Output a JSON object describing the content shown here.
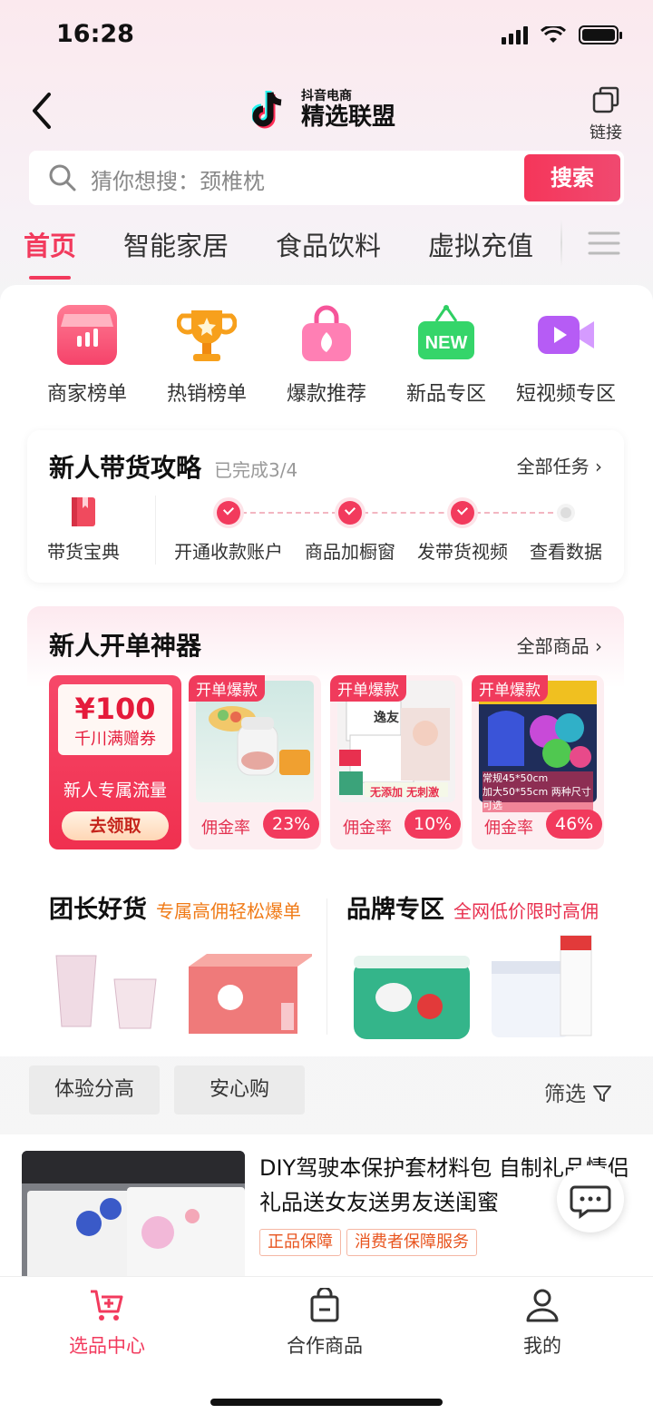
{
  "status": {
    "time": "16:28"
  },
  "header": {
    "logo_small": "抖音电商",
    "logo_big": "精选联盟",
    "link_label": "链接"
  },
  "search": {
    "placeholder": "猜你想搜：颈椎枕",
    "button": "搜索"
  },
  "tabs": [
    {
      "label": "首页"
    },
    {
      "label": "智能家居"
    },
    {
      "label": "食品饮料"
    },
    {
      "label": "虚拟充值"
    }
  ],
  "categories": [
    {
      "label": "商家榜单",
      "icon": "store-chart-icon",
      "color": "#f5436a"
    },
    {
      "label": "热销榜单",
      "icon": "trophy-icon",
      "color": "#f7a01c"
    },
    {
      "label": "爆款推荐",
      "icon": "hot-bag-icon",
      "color": "#f6559a"
    },
    {
      "label": "新品专区",
      "icon": "new-sign-icon",
      "color": "#2fcf63"
    },
    {
      "label": "短视频专区",
      "icon": "video-camera-icon",
      "color": "#a24cf3"
    }
  ],
  "newbie": {
    "title": "新人带货攻略",
    "progress": "已完成3/4",
    "all_link": "全部任务",
    "guide": "带货宝典",
    "steps": [
      {
        "label": "开通收款账户",
        "done": true
      },
      {
        "label": "商品加橱窗",
        "done": true
      },
      {
        "label": "发带货视频",
        "done": true
      },
      {
        "label": "查看数据",
        "done": false
      }
    ]
  },
  "opener": {
    "title": "新人开单神器",
    "all_link": "全部商品",
    "coupon": {
      "amount": "¥100",
      "desc": "千川满赠券",
      "flow": "新人专属流量",
      "button": "去领取"
    },
    "products": [
      {
        "badge": "开单爆款",
        "rate_label": "佣金率",
        "rate": "23%"
      },
      {
        "badge": "开单爆款",
        "rate_label": "佣金率",
        "rate": "10%",
        "img_text": "逸友",
        "img_text2": "无添加 无刺激"
      },
      {
        "badge": "开单爆款",
        "rate_label": "佣金率",
        "rate": "46%",
        "img_text": "常规45*50cm",
        "img_text2": "加大50*55cm 两种尺寸可选"
      }
    ]
  },
  "deals": [
    {
      "title": "团长好货",
      "sub": "专属高佣轻松爆单",
      "sub_color": "#f07b18"
    },
    {
      "title": "品牌专区",
      "sub": "全网低价限时高佣",
      "sub_color": "#e8304f"
    }
  ],
  "filters": {
    "chips": [
      "体验分高",
      "安心购"
    ],
    "filter_label": "筛选"
  },
  "item": {
    "title": "DIY驾驶本保护套材料包 自制礼品情侣礼品送女友送男友送闺蜜",
    "tags": [
      "正品保障",
      "消费者保障服务"
    ]
  },
  "bottom_nav": [
    {
      "label": "选品中心",
      "active": true
    },
    {
      "label": "合作商品",
      "active": false
    },
    {
      "label": "我的",
      "active": false
    }
  ],
  "colors": {
    "accent": "#f23a5d"
  }
}
